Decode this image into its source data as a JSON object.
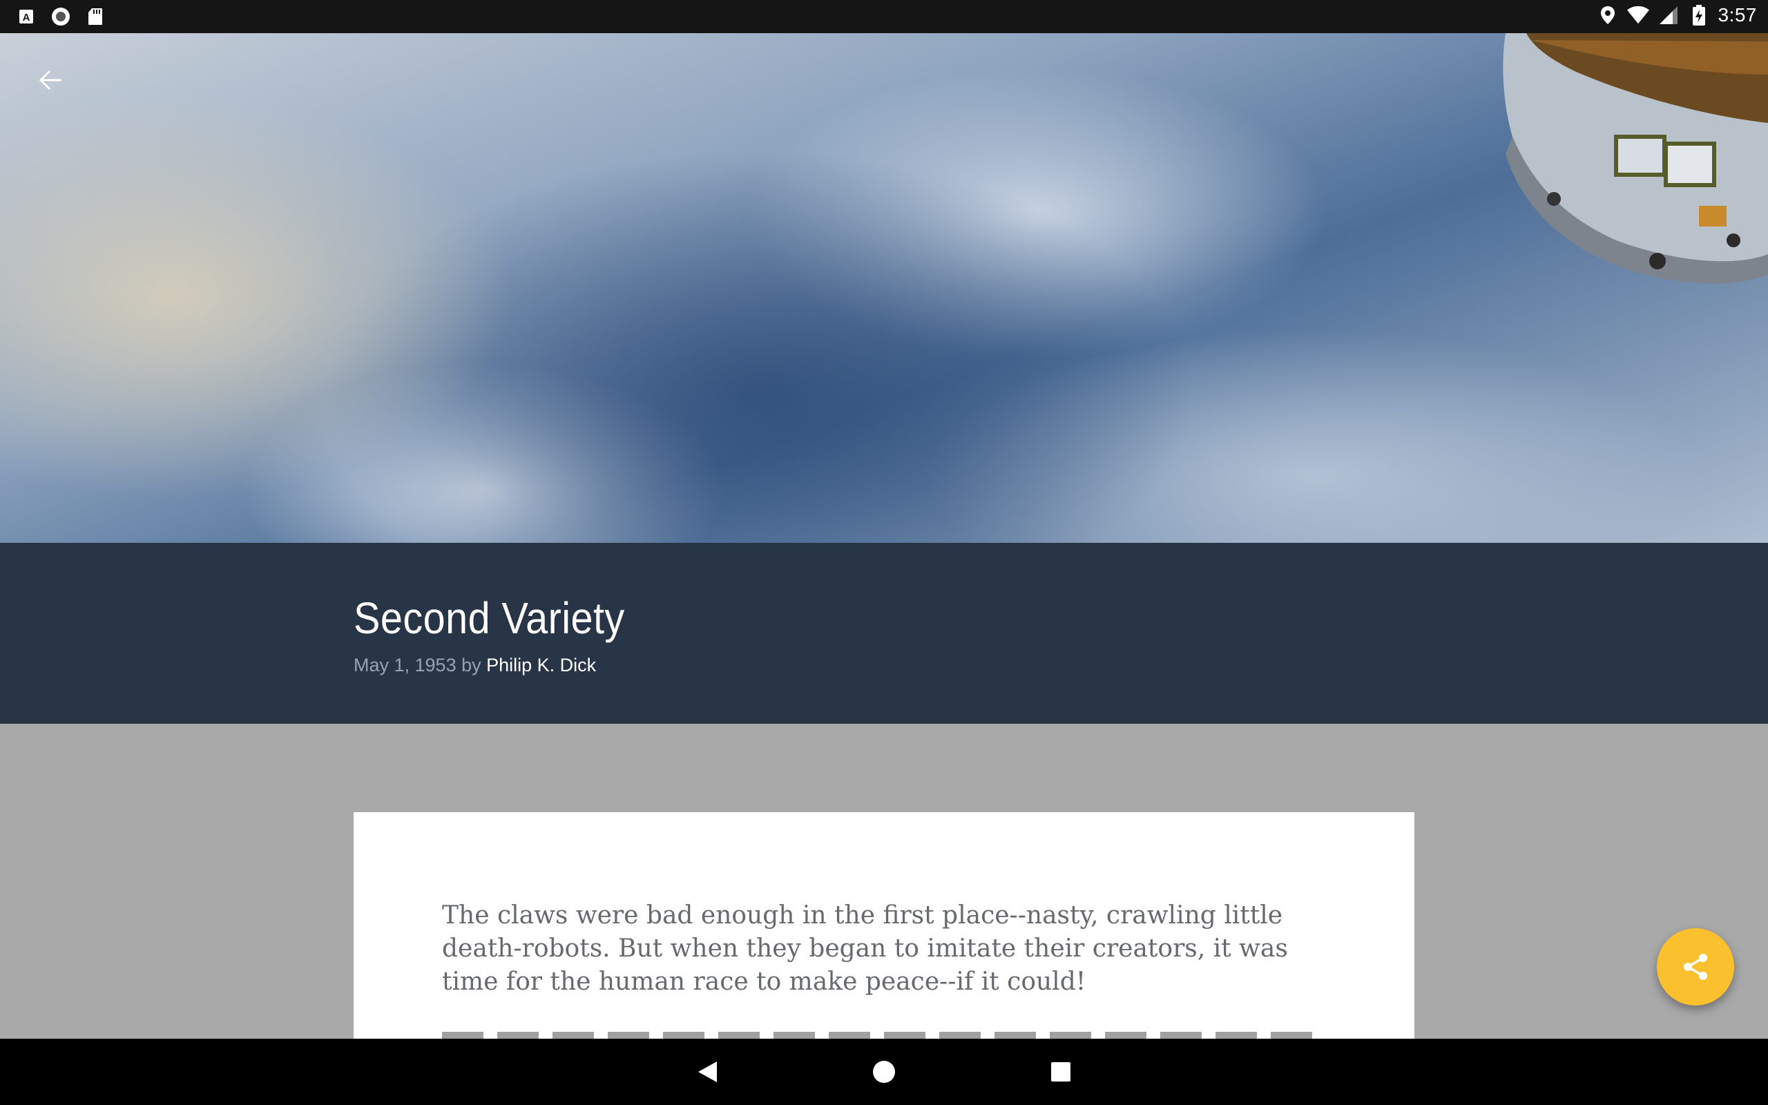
{
  "status_bar": {
    "time": "3:57",
    "left_icons": [
      "text-a-notification-icon",
      "record-notification-icon",
      "sd-card-icon"
    ],
    "right_icons": [
      "location-icon",
      "wifi-icon",
      "cell-signal-icon",
      "battery-charging-icon"
    ]
  },
  "hero": {
    "back_icon": "arrow-back-icon"
  },
  "article": {
    "title": "Second Variety",
    "date": "May 1, 1953",
    "by": " by ",
    "author": "Philip K. Dick",
    "lead": "The claws were bad enough in the first place--nasty, crawling little death-robots. But when they began to imitate their creators, it was time for the human race to make peace--if it could!"
  },
  "fab": {
    "icon": "share-icon"
  },
  "nav_bar": {
    "icons": [
      "back-triangle-icon",
      "home-circle-icon",
      "recents-square-icon"
    ]
  },
  "colors": {
    "status_bar": "#151515",
    "title_band": "#283547",
    "content_bg": "#a9a9a9",
    "card": "#ffffff",
    "fab": "#fbc02d",
    "nav_bar": "#000000"
  }
}
